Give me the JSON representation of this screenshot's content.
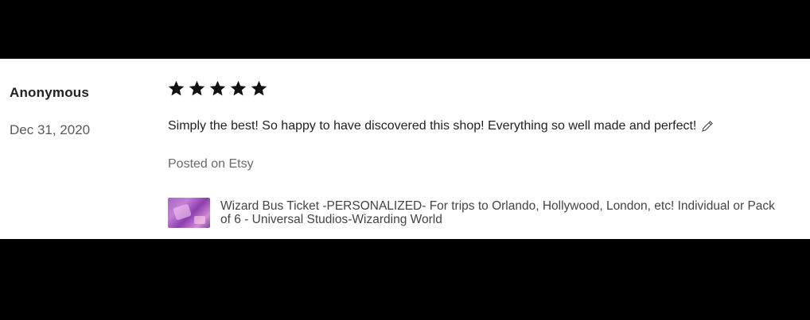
{
  "review": {
    "reviewer_name": "Anonymous",
    "date": "Dec 31, 2020",
    "rating": 5,
    "rating_max": 5,
    "text": "Simply the best! So happy to have discovered this shop! Everything so well made and perfect!",
    "edited_icon": "pencil-icon",
    "source": "Posted on Etsy",
    "item": {
      "title": "Wizard Bus Ticket -PERSONALIZED- For trips to Orlando, Hollywood, London, etc! Individual or Pack of 6 - Universal Studios-Wizarding World",
      "thumbnail_icon": "product-thumbnail"
    }
  },
  "colors": {
    "frame": "#000000",
    "background": "#ffffff",
    "star": "#111111",
    "text": "#222222",
    "muted": "#6b6b6b"
  }
}
